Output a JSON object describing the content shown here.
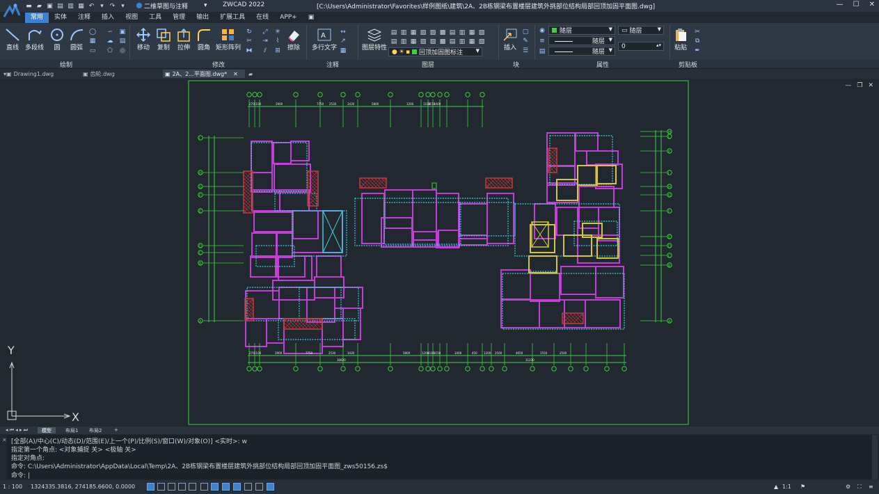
{
  "window": {
    "workspace": "二维草图与注释",
    "app_title": "ZWCAD 2022",
    "file_title": "[C:\\Users\\Administrator\\Favorites\\样例图纸\\建筑\\2A、2B栋钢梁布置楼层建筑外挑部位结构局部回顶加固平面图.dwg]"
  },
  "tabs": [
    "常用",
    "实体",
    "注释",
    "插入",
    "视图",
    "工具",
    "管理",
    "输出",
    "扩展工具",
    "在线",
    "APP+"
  ],
  "ribbon": {
    "draw": {
      "line": "直线",
      "polyline": "多段线",
      "circle": "圆",
      "arc": "圆弧",
      "label": "绘制"
    },
    "modify": {
      "move": "移动",
      "copy": "复制",
      "stretch": "拉伸",
      "fillet": "圆角",
      "array": "矩形阵列",
      "erase": "擦除",
      "label": "修改"
    },
    "annotation": {
      "mtext": "多行文字",
      "label": "注释"
    },
    "layer": {
      "props": "图层特性",
      "current_layer": "回顶加固图标注",
      "label": "图层"
    },
    "block": {
      "insert": "插入",
      "label": "块"
    },
    "properties": {
      "color": "随层",
      "layer_combo": "随层",
      "linetype": "随层",
      "lineweight": "随层",
      "value": "0",
      "label": "属性"
    },
    "clipboard": {
      "paste": "粘贴",
      "label": "剪贴板"
    }
  },
  "doc_tabs": [
    "Drawing1.dwg",
    "齿轮.dwg",
    "2A、2...平面图.dwg*"
  ],
  "layout_tabs": [
    "模型",
    "布局1",
    "布局2"
  ],
  "layout_add": "+",
  "drawing": {
    "ucs_x": "X",
    "ucs_y": "Y",
    "total_dim_bottom_left": "30820",
    "total_dim_bottom_right": "31230",
    "left_axis_labels": [
      "J",
      "H",
      "G",
      "F",
      "E",
      "D",
      "C",
      "B",
      "A"
    ],
    "right_axis_labels": [
      "M",
      "L",
      "K",
      "J",
      "H",
      "G",
      "F",
      "E",
      "D",
      "C",
      "B",
      "A"
    ],
    "top_dims": [
      "270",
      "1100",
      "2900",
      "7750",
      "2530",
      "3430",
      "5800",
      "1200",
      "1100",
      "3150",
      "3400"
    ],
    "bottom_dims_left": [
      "270",
      "1100",
      "2900",
      "7750",
      "2530",
      "3430"
    ],
    "bottom_dims_right": [
      "5800",
      "1200",
      "1100",
      "3150",
      "3400",
      "450",
      "1200",
      "2500",
      "4650",
      "1550",
      "2500"
    ]
  },
  "command": {
    "lines": [
      "[全部(A)/中心(C)/动态(D)/范围(E)/上一个(P)/比例(S)/窗口(W)/对象(O)] <实时>: w",
      "指定第一个角点: <对象捕捉 关> <极轴 关>",
      "指定对角点:",
      "命令: C:\\Users\\Administrator\\AppData\\Local\\Temp\\2A、2B栋钢梁布置楼层建筑外挑部位结构局部回顶加固平面图_zws50156.zs$"
    ],
    "prompt": "命令:"
  },
  "status": {
    "scale": "1 : 100",
    "coords": "1324335.3816, 274185.6600, 0.0000",
    "annoscale": "1:1"
  },
  "colors": {
    "accent": "#3c82d0",
    "magenta": "#c23fd6",
    "cyan": "#3fc9d9",
    "green": "#3fcf3f",
    "yellow": "#d6c53f",
    "red": "#c8383d"
  }
}
